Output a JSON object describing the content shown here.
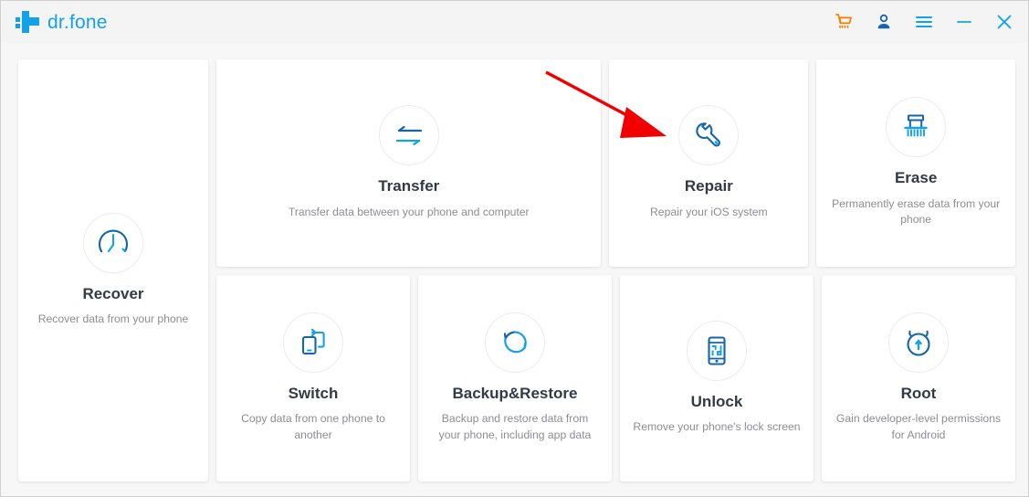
{
  "window": {
    "brand_name": "dr.fone",
    "logo_icon": "plus-cross-logo",
    "controls": [
      {
        "name": "cart-icon",
        "label": "Shopping cart",
        "color": "#f08000"
      },
      {
        "name": "account-icon",
        "label": "Account",
        "color": "#1565a8"
      },
      {
        "name": "menu-icon",
        "label": "Menu",
        "color": "#13a2e8"
      },
      {
        "name": "minimize-icon",
        "label": "Minimize",
        "color": "#13a2e8"
      },
      {
        "name": "close-icon",
        "label": "Close",
        "color": "#13a2e8"
      }
    ]
  },
  "colors": {
    "brand_blue": "#13a2e8",
    "dark_blue": "#1565a8",
    "cart_orange": "#f08000",
    "title_text": "#323a45",
    "desc_text": "#8d8d92",
    "card_bg": "#ffffff",
    "workspace_bg": "#f7f7f7",
    "titlebar_bg": "#f4f4f4",
    "annotation_red": "#f00000"
  },
  "modules": {
    "recover": {
      "title": "Recover",
      "description": "Recover data from your phone",
      "icon": "clock-recover-icon"
    },
    "transfer": {
      "title": "Transfer",
      "description": "Transfer data between your phone and computer",
      "icon": "two-way-arrows-icon"
    },
    "repair": {
      "title": "Repair",
      "description": "Repair your iOS system",
      "icon": "wrench-icon"
    },
    "erase": {
      "title": "Erase",
      "description": "Permanently erase data from your phone",
      "icon": "shredder-icon"
    },
    "switch": {
      "title": "Switch",
      "description": "Copy data from one phone to another",
      "icon": "phone-switch-icon"
    },
    "backup_restore": {
      "title": "Backup&Restore",
      "description": "Backup and restore data from your phone, including app data",
      "icon": "circular-refresh-icon"
    },
    "unlock": {
      "title": "Unlock",
      "description": "Remove your phone's lock screen",
      "icon": "phone-pattern-lock-icon"
    },
    "root": {
      "title": "Root",
      "description": "Gain developer-level permissions for Android",
      "icon": "android-root-icon"
    }
  },
  "annotation": {
    "type": "arrow",
    "points_to": "repair",
    "color": "#f00000"
  }
}
